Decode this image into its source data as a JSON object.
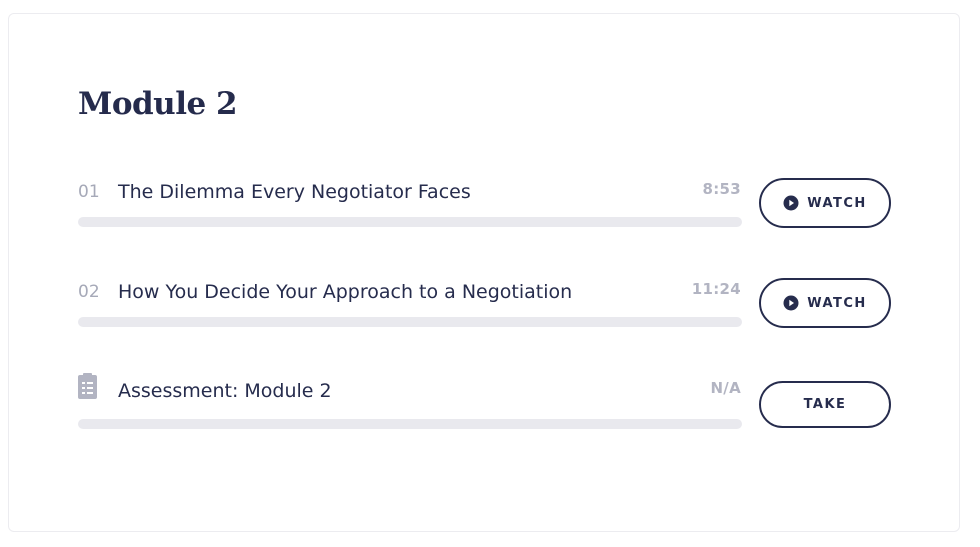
{
  "module": {
    "title": "Module 2"
  },
  "lessons": [
    {
      "number": "01",
      "title": "The Dilemma Every Negotiator Faces",
      "duration": "8:53",
      "action_label": "WATCH",
      "progress": 0
    },
    {
      "number": "02",
      "title": "How You Decide Your Approach to a Negotiation",
      "duration": "11:24",
      "action_label": "WATCH",
      "progress": 0
    }
  ],
  "assessment": {
    "icon": "assessment-document-icon",
    "title": "Assessment: Module 2",
    "duration": "N/A",
    "action_label": "TAKE",
    "progress": 0
  },
  "colors": {
    "primary": "#262c4d",
    "muted": "#a6a9b8",
    "track": "#e9e9ee"
  }
}
